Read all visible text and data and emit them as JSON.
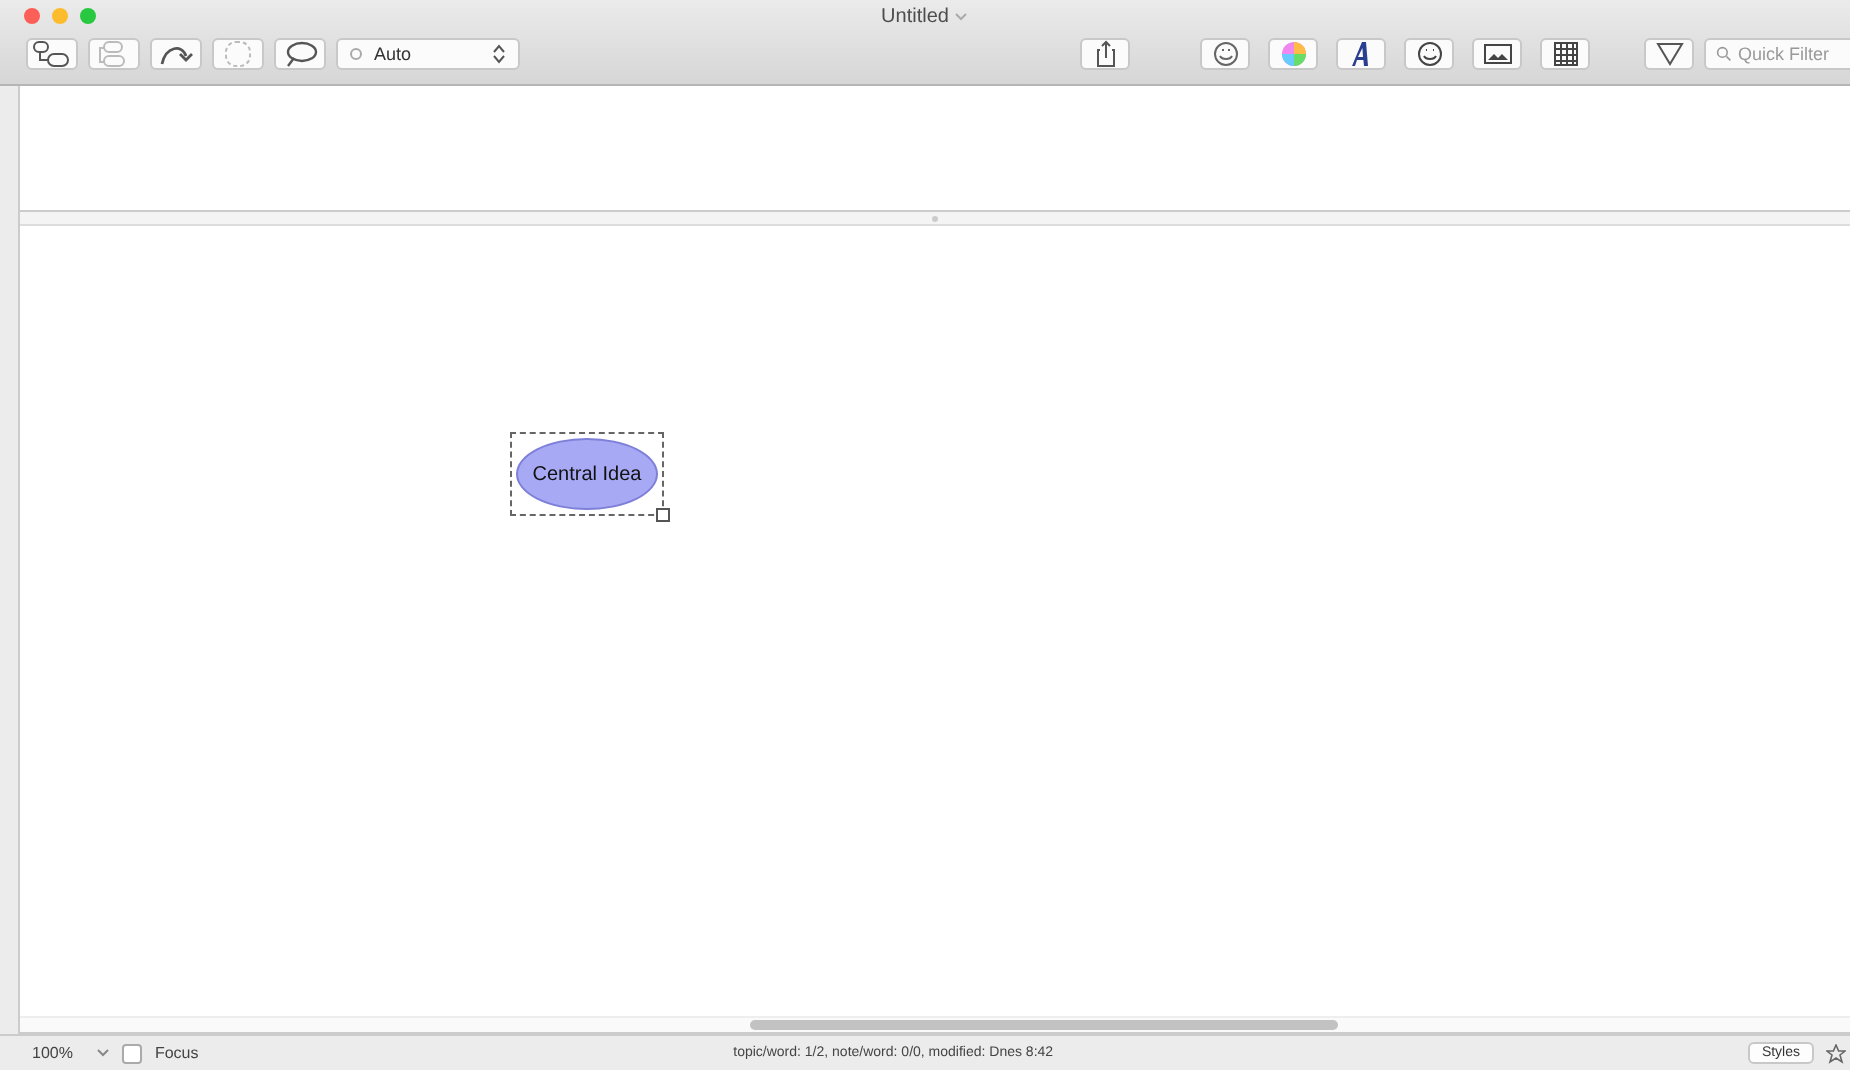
{
  "window": {
    "title": "Untitled"
  },
  "toolbar": {
    "left_tools": [
      {
        "kind": "child",
        "disabled": false
      },
      {
        "kind": "sibling",
        "disabled": true
      },
      {
        "kind": "connect",
        "disabled": false
      },
      {
        "kind": "boundary",
        "disabled": true
      },
      {
        "kind": "callout",
        "disabled": false
      }
    ],
    "layout_select": {
      "value": "Auto"
    },
    "right_tools": [
      {
        "kind": "share"
      },
      {
        "kind": "smile"
      },
      {
        "kind": "colors"
      },
      {
        "kind": "font"
      },
      {
        "kind": "emoji"
      },
      {
        "kind": "image"
      },
      {
        "kind": "table"
      }
    ],
    "quick_filter": {
      "placeholder": "Quick Filter"
    }
  },
  "canvas": {
    "topics": [
      {
        "label": "Central Idea",
        "selected": true
      }
    ]
  },
  "status_bar": {
    "zoom": "100%",
    "focus": {
      "label": "Focus",
      "checked": false
    },
    "info": "topic/word: 1/2, note/word: 0/0, modified: Dnes 8:42",
    "styles_button": "Styles"
  }
}
